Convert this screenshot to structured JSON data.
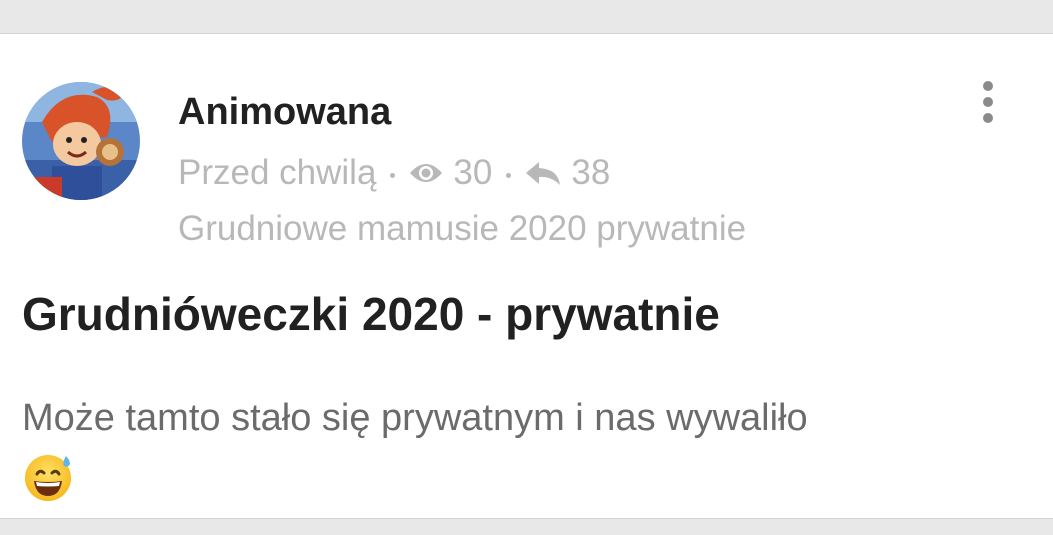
{
  "post": {
    "author": "Animowana",
    "time": "Przed chwilą",
    "views": "30",
    "replies": "38",
    "group": "Grudniowe mamusie 2020 prywatnie",
    "title": "Grudnióweczki 2020 - prywatnie",
    "body": "Może tamto stało się prywatnym i nas wywaliło",
    "emoji": "grinning-face-with-sweat-icon"
  },
  "icons": {
    "views": "eye-icon",
    "replies": "reply-arrow-icon",
    "menu": "more-vertical-icon",
    "avatar": "avatar-image"
  },
  "colors": {
    "text_primary": "#212121",
    "text_meta": "#b8b8b8",
    "text_body": "#6b6b6b",
    "background": "#e8e8e8",
    "card": "#ffffff"
  }
}
